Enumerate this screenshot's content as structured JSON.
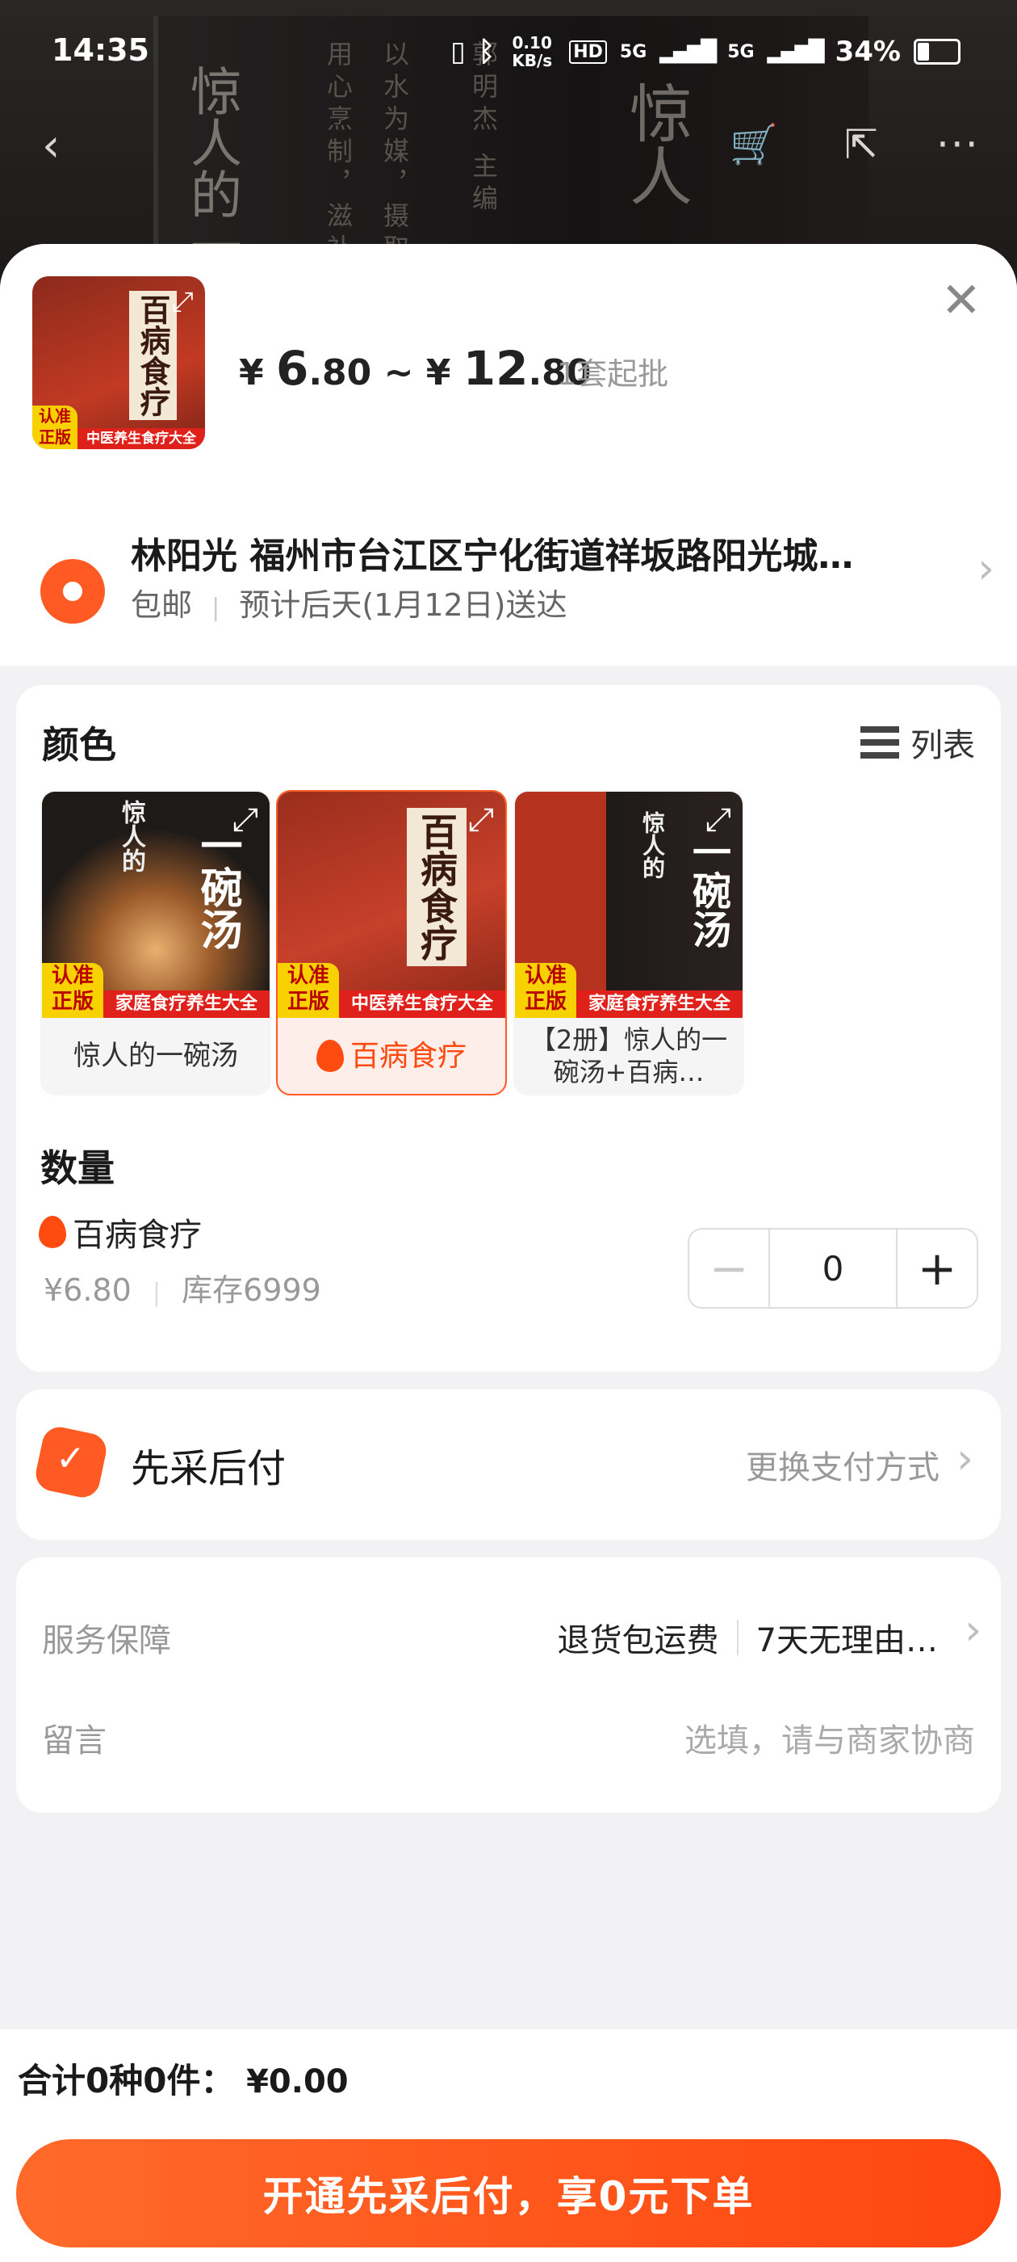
{
  "status_bar": {
    "time": "14:35",
    "net_speed": "0.10 KB/s",
    "signal_1": "5G",
    "signal_2": "5G",
    "battery": "34%"
  },
  "background_book": {
    "title": "惊人的一",
    "editor": "郭明杰 主编",
    "tagline": "以水为媒，摄取",
    "tagline2": "用心烹制，滋补",
    "cover_big": "惊人"
  },
  "header": {
    "price_currency": "¥",
    "price_min_int": "6",
    "price_min_dec": ".80",
    "price_sep": "~",
    "price_max_int": "12",
    "price_max_dec": ".80",
    "moq": "1套起批",
    "thumb_title": "百病食疗",
    "thumb_badge": "认准正版",
    "thumb_strip": "中医养生食疗大全"
  },
  "address": {
    "line": "林阳光 福州市台江区宁化街道祥坂路阳光城…",
    "shipping": "包邮",
    "eta": "预计后天(1月12日)送达"
  },
  "color_section": {
    "title": "颜色",
    "list_toggle": "列表",
    "variants": [
      {
        "label": "惊人的一碗汤",
        "book_title": "一碗汤",
        "book_top": "惊人的",
        "strip": "家庭食疗养生大全",
        "badge": "认准正版",
        "selected": false
      },
      {
        "label": "百病食疗",
        "book_title": "百病食疗",
        "book_top": "",
        "strip": "中医养生食疗大全",
        "badge": "认准正版",
        "selected": true
      },
      {
        "label": "【2册】惊人的一碗汤+百病…",
        "book_title": "一碗汤",
        "book_top": "惊人的",
        "strip": "家庭食疗养生大全",
        "badge": "认准正版",
        "selected": false
      }
    ]
  },
  "quantity_section": {
    "title": "数量",
    "item_name": "百病食疗",
    "item_price": "¥6.80",
    "stock": "库存6999",
    "value": "0"
  },
  "pay_later": {
    "title": "先采后付",
    "change_link": "更换支付方式"
  },
  "service": {
    "label": "服务保障",
    "tag1": "退货包运费",
    "tag2": "7天无理由…",
    "message_label": "留言",
    "message_placeholder": "选填，请与商家协商"
  },
  "footer": {
    "total_label": "合计0种0件：",
    "total_value": "¥0.00",
    "cta": "开通先采后付，享0元下单"
  },
  "colors": {
    "accent": "#ff5a24",
    "cta": "#ff4610",
    "sheet_bg": "#f2f2f4"
  }
}
